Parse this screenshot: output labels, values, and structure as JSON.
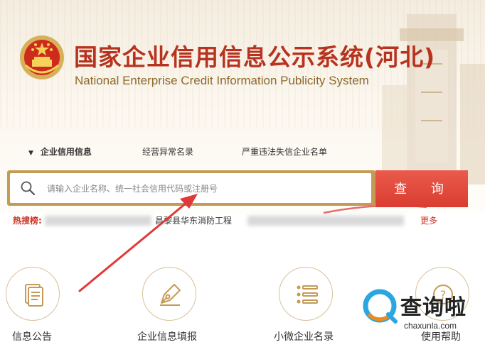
{
  "header": {
    "title_cn": "国家企业信用信息公示系统(河北)",
    "title_en": "National Enterprise Credit Information Publicity System"
  },
  "tabs": [
    {
      "label": "企业信用信息",
      "active": true
    },
    {
      "label": "经营异常名录",
      "active": false
    },
    {
      "label": "严重违法失信企业名单",
      "active": false
    }
  ],
  "search": {
    "placeholder": "请输入企业名称、统一社会信用代码或注册号",
    "button_label": "查 询"
  },
  "hot_search": {
    "label": "热搜榜:",
    "visible_item": "昌黎县华东消防工程",
    "more_label": "更多"
  },
  "quick_links": [
    {
      "label": "信息公告",
      "icon": "document-icon"
    },
    {
      "label": "企业信息填报",
      "icon": "pen-nib-icon"
    },
    {
      "label": "小微企业名录",
      "icon": "list-icon"
    },
    {
      "label": "使用帮助",
      "icon": "help-icon"
    }
  ],
  "watermark": {
    "text": "查询啦",
    "domain": "chaxunla.com"
  },
  "colors": {
    "brand_red": "#d93d30",
    "title_red": "#b8331f",
    "gold": "#c49b55",
    "annotation_arrow": "#e0393a"
  }
}
